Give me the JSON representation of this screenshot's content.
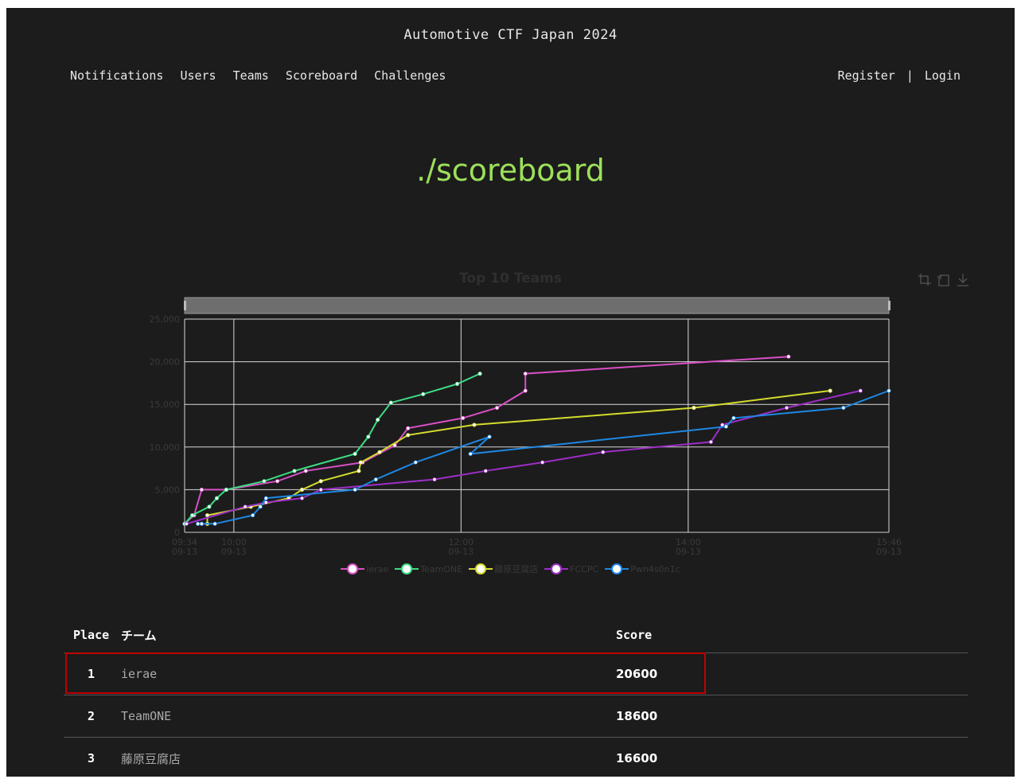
{
  "site": {
    "title": "Automotive CTF Japan 2024"
  },
  "nav": {
    "items": [
      "Notifications",
      "Users",
      "Teams",
      "Scoreboard",
      "Challenges"
    ],
    "register": "Register",
    "separator": "|",
    "login": "Login"
  },
  "page": {
    "heading": "./scoreboard"
  },
  "toolbox": {
    "icons": [
      "zoom-select-icon",
      "zoom-reset-icon",
      "download-icon"
    ]
  },
  "chart_data": {
    "type": "line",
    "title": "Top 10 Teams",
    "x_ticks": [
      {
        "t": 574,
        "time": "09:34",
        "date": "09-13"
      },
      {
        "t": 600,
        "time": "10:00",
        "date": "09-13"
      },
      {
        "t": 720,
        "time": "12:00",
        "date": "09-13"
      },
      {
        "t": 840,
        "time": "14:00",
        "date": "09-13"
      },
      {
        "t": 946,
        "time": "15:46",
        "date": "09-13"
      }
    ],
    "xlim": [
      574,
      946
    ],
    "ylim": [
      0,
      25000
    ],
    "y_ticks": [
      0,
      5000,
      10000,
      15000,
      20000,
      25000
    ],
    "y_tick_labels": [
      "0",
      "5,000",
      "10,000",
      "15,000",
      "20,000",
      "25,000"
    ],
    "grid": true,
    "legend_position": "bottom",
    "data_zoom": "top",
    "series": [
      {
        "name": "ierae",
        "color": "#d94fc6",
        "points": [
          [
            574,
            1000
          ],
          [
            579,
            2000
          ],
          [
            583,
            5000
          ],
          [
            596,
            5000
          ],
          [
            623,
            6000
          ],
          [
            638,
            7200
          ],
          [
            668,
            8200
          ],
          [
            685,
            10200
          ],
          [
            692,
            12200
          ],
          [
            721,
            13400
          ],
          [
            739,
            14600
          ],
          [
            754,
            16600
          ],
          [
            754,
            18600
          ],
          [
            893,
            20600
          ]
        ]
      },
      {
        "name": "TeamONE",
        "color": "#3ddc84",
        "points": [
          [
            574,
            1000
          ],
          [
            578,
            2000
          ],
          [
            587,
            3000
          ],
          [
            591,
            4000
          ],
          [
            596,
            5000
          ],
          [
            616,
            6000
          ],
          [
            632,
            7200
          ],
          [
            664,
            9200
          ],
          [
            671,
            11200
          ],
          [
            676,
            13200
          ],
          [
            683,
            15200
          ],
          [
            700,
            16200
          ],
          [
            718,
            17400
          ],
          [
            730,
            18600
          ]
        ]
      },
      {
        "name": "藤原豆腐店",
        "color": "#d4dc2c",
        "points": [
          [
            586,
            1000
          ],
          [
            586,
            2000
          ],
          [
            609,
            3000
          ],
          [
            629,
            4000
          ],
          [
            636,
            5000
          ],
          [
            646,
            6000
          ],
          [
            666,
            7200
          ],
          [
            667,
            8200
          ],
          [
            677,
            9400
          ],
          [
            692,
            11400
          ],
          [
            727,
            12600
          ],
          [
            843,
            14600
          ],
          [
            915,
            16600
          ]
        ]
      },
      {
        "name": "FCCPC",
        "color": "#9d2ec8",
        "points": [
          [
            575,
            1000
          ],
          [
            606,
            3000
          ],
          [
            617,
            3500
          ],
          [
            636,
            4000
          ],
          [
            646,
            5000
          ],
          [
            706,
            6200
          ],
          [
            733,
            7200
          ],
          [
            763,
            8200
          ],
          [
            795,
            9400
          ],
          [
            852,
            10600
          ],
          [
            858,
            12600
          ],
          [
            892,
            14600
          ],
          [
            931,
            16600
          ]
        ]
      },
      {
        "name": "Pwn4s0n1c",
        "color": "#1e88e5",
        "points": [
          [
            581,
            1000
          ],
          [
            583,
            1000
          ],
          [
            590,
            1000
          ],
          [
            610,
            2000
          ],
          [
            614,
            3000
          ],
          [
            617,
            4000
          ],
          [
            664,
            5000
          ],
          [
            675,
            6200
          ],
          [
            696,
            8200
          ],
          [
            735,
            11200
          ],
          [
            725,
            9200
          ],
          [
            860,
            12400
          ],
          [
            864,
            13400
          ],
          [
            922,
            14600
          ],
          [
            946,
            16600
          ]
        ]
      }
    ]
  },
  "table": {
    "headers": {
      "place": "Place",
      "team": "チーム",
      "score": "Score"
    },
    "rows": [
      {
        "place": "1",
        "team": "ierae",
        "score": "20600"
      },
      {
        "place": "2",
        "team": "TeamONE",
        "score": "18600"
      },
      {
        "place": "3",
        "team": "藤原豆腐店",
        "score": "16600"
      }
    ]
  },
  "colors": {
    "accent": "#9de05a",
    "background": "#1c1c1c",
    "highlight": "#c00000"
  }
}
